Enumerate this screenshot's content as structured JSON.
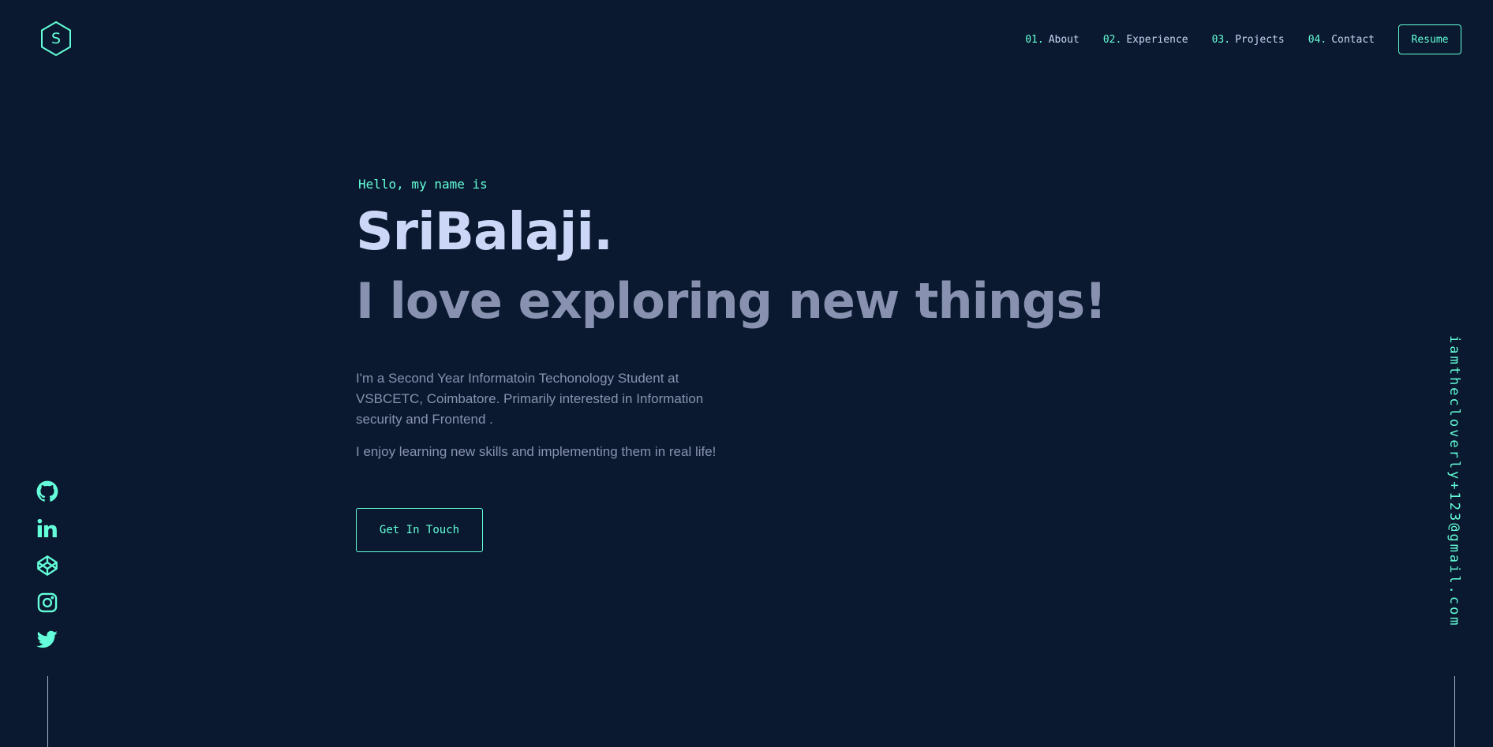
{
  "logo": {
    "letter": "S"
  },
  "nav": {
    "items": [
      {
        "num": "01.",
        "label": "About"
      },
      {
        "num": "02.",
        "label": "Experience"
      },
      {
        "num": "03.",
        "label": "Projects"
      },
      {
        "num": "04.",
        "label": "Contact"
      }
    ],
    "resume_label": "Resume"
  },
  "hero": {
    "greeting": "Hello, my name is",
    "name": "SriBalaji.",
    "tagline": "I love exploring new things!",
    "bio": [
      "I'm a Second Year Informatoin Techonology Student at VSBCETC, Coimbatore. Primarily interested in Information security and Frontend .",
      "I enjoy learning new skills and implementing them in real life!"
    ],
    "cta_label": "Get In Touch"
  },
  "socials": [
    "github-icon",
    "linkedin-icon",
    "codepen-icon",
    "instagram-icon",
    "twitter-icon"
  ],
  "email": "iamthecloverly+123@gmail.com",
  "colors": {
    "background": "#0a192f",
    "accent": "#64ffda",
    "heading": "#ccd6f6",
    "text": "#8892b0"
  }
}
